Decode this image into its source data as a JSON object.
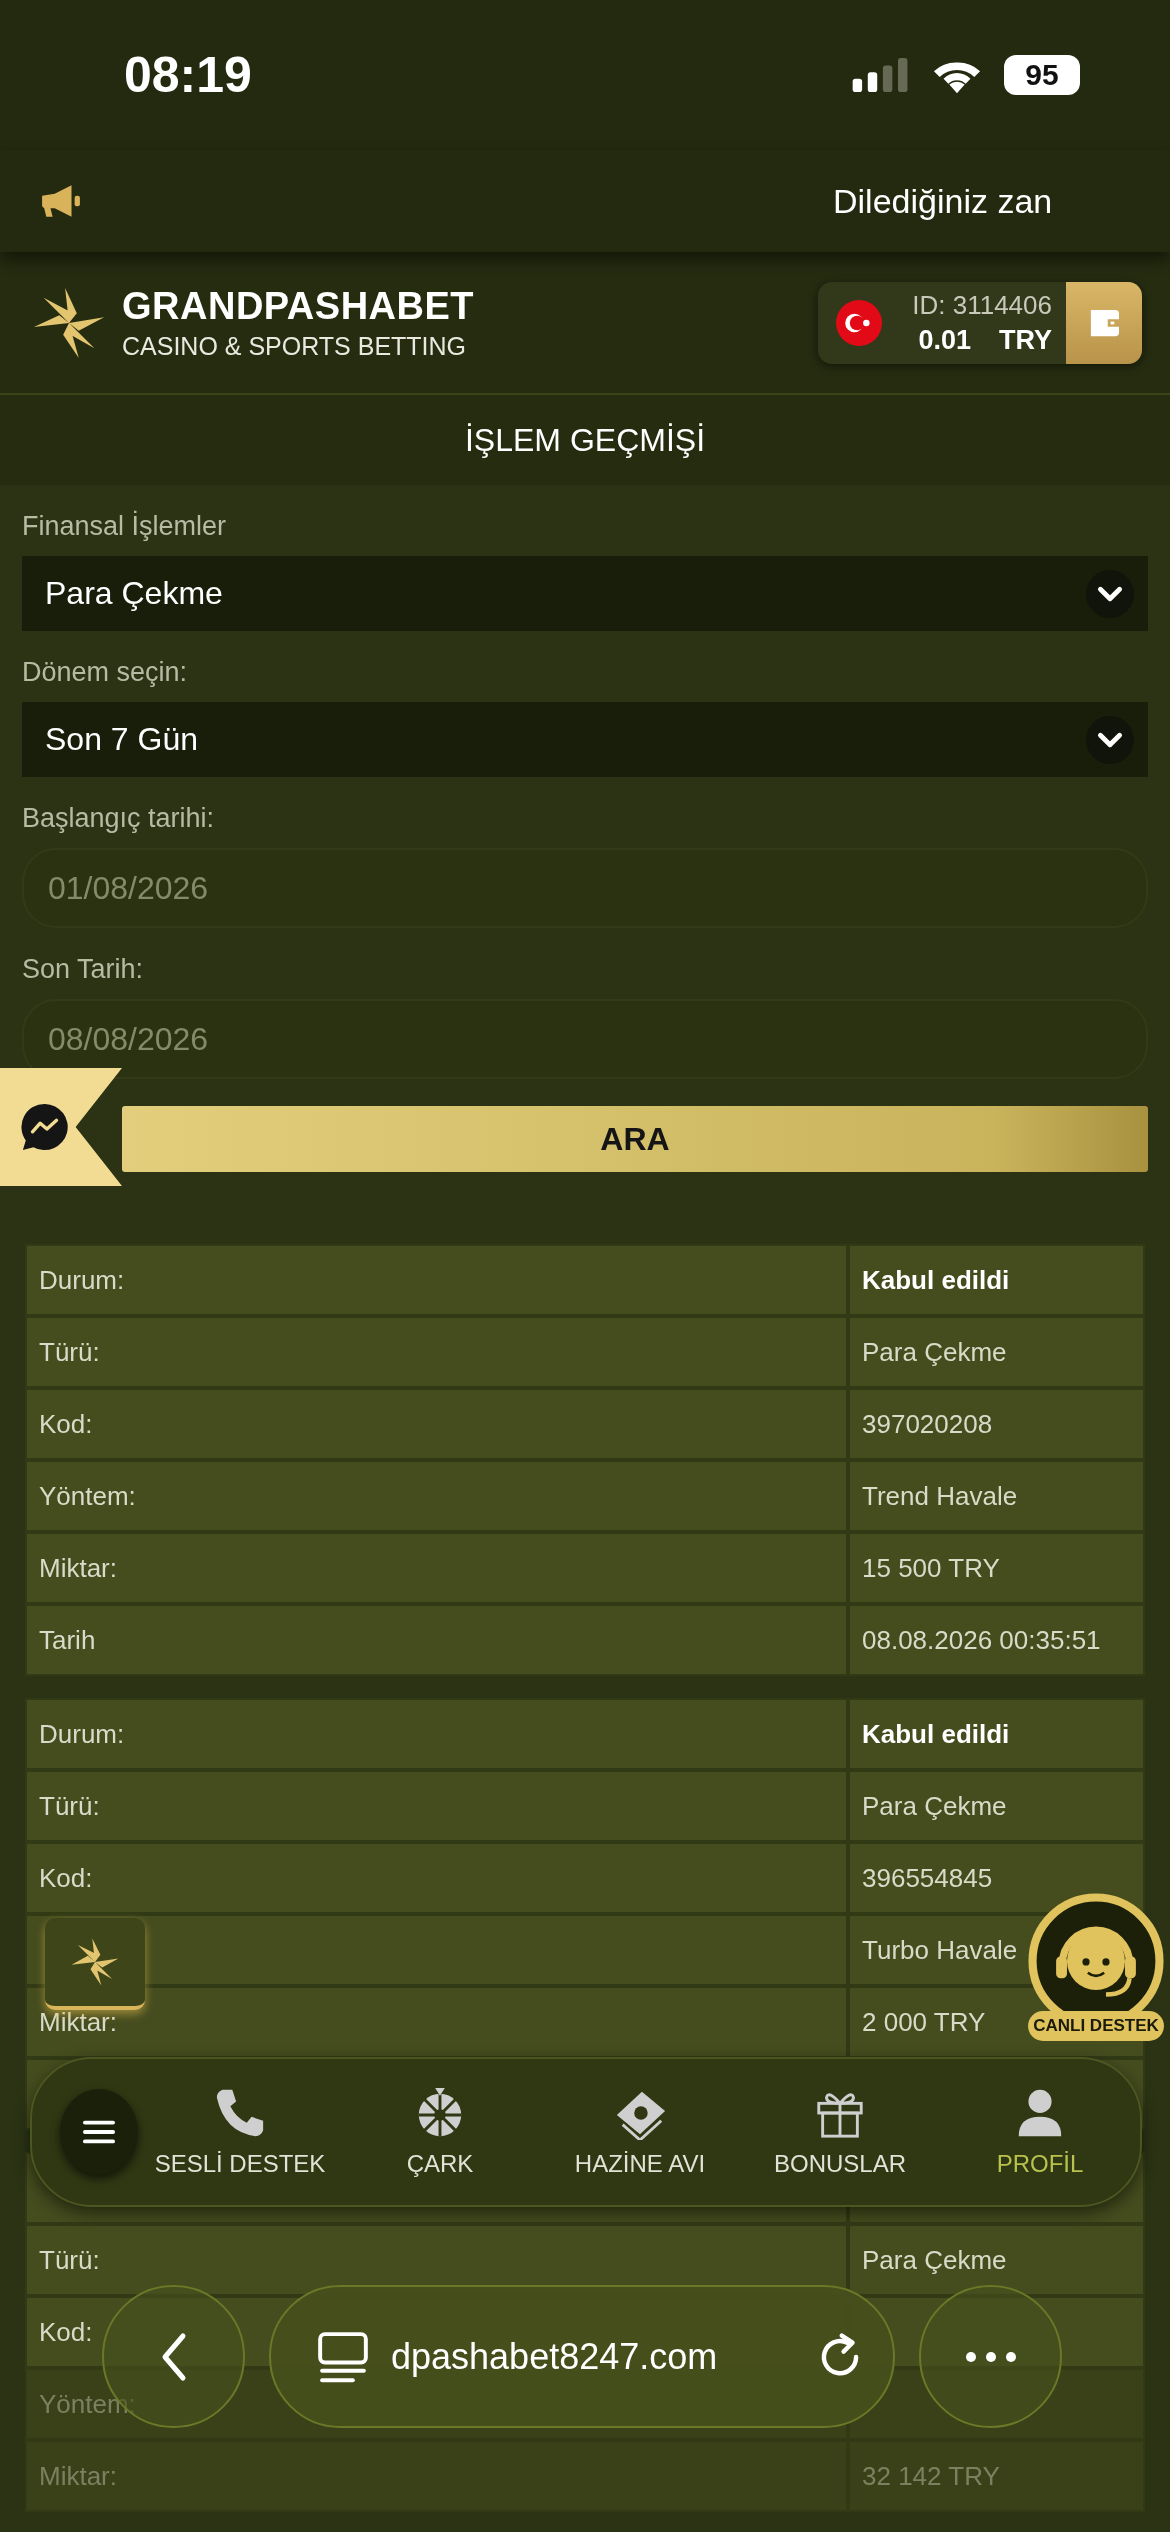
{
  "status_bar": {
    "time": "08:19",
    "battery": "95"
  },
  "announcement": {
    "text": "Dilediğiniz zan"
  },
  "header": {
    "brand": "GRANDPASHABET",
    "tagline": "CASINO & SPORTS BETTING",
    "account": {
      "id": "ID: 3114406",
      "balance": "0.01",
      "currency": "TRY"
    }
  },
  "page_title": "İŞLEM GEÇMİŞİ",
  "filters": [
    {
      "kind": "select",
      "label": "Finansal İşlemler",
      "value": "Para Çekme"
    },
    {
      "kind": "select",
      "label": "Dönem seçin:",
      "value": "Son 7 Gün"
    },
    {
      "kind": "date",
      "label": "Başlangıç tarihi:",
      "value": "01/08/2026"
    },
    {
      "kind": "date",
      "label": "Son Tarih:",
      "value": "08/08/2026"
    }
  ],
  "search_button": "ARA",
  "transactions": [
    {
      "rows": [
        {
          "kind": "status",
          "label": "Durum:",
          "value": "Kabul edildi"
        },
        {
          "kind": "field",
          "label": "Türü:",
          "value": "Para Çekme"
        },
        {
          "kind": "field",
          "label": "Kod:",
          "value": "397020208"
        },
        {
          "kind": "field",
          "label": "Yöntem:",
          "value": "Trend Havale"
        },
        {
          "kind": "field",
          "label": "Miktar:",
          "value": "15 500 TRY"
        },
        {
          "kind": "field",
          "label": "Tarih",
          "value": "08.08.2026 00:35:51"
        }
      ]
    },
    {
      "rows": [
        {
          "kind": "status",
          "label": "Durum:",
          "value": "Kabul edildi"
        },
        {
          "kind": "field",
          "label": "Türü:",
          "value": "Para Çekme"
        },
        {
          "kind": "field",
          "label": "Kod:",
          "value": "396554845"
        },
        {
          "kind": "field",
          "value": "Turbo Havale"
        },
        {
          "kind": "field",
          "label": "Miktar:",
          "value": "2 000 TRY"
        },
        {
          "kind": "field"
        }
      ]
    },
    {
      "rows": [
        {
          "kind": "status"
        },
        {
          "kind": "field",
          "label": "Türü:",
          "value": "Para Çekme"
        },
        {
          "kind": "field",
          "label": "Kod:"
        },
        {
          "kind": "field",
          "label": "Yöntem:",
          "dimmed": true
        },
        {
          "kind": "field",
          "label": "Miktar:",
          "value": "32 142 TRY",
          "dimmed": true
        }
      ]
    }
  ],
  "live_support": {
    "label": "CANLI DESTEK"
  },
  "bottom_nav": {
    "items": [
      {
        "kind": "phone",
        "label": "SESLİ DESTEK",
        "selected": false
      },
      {
        "kind": "wheel",
        "label": "ÇARK",
        "selected": false
      },
      {
        "kind": "money",
        "label": "HAZİNE AVI",
        "selected": false
      },
      {
        "kind": "gift",
        "label": "BONUSLAR",
        "selected": false
      },
      {
        "kind": "person",
        "label": "PROFİL",
        "selected": true
      }
    ]
  },
  "browser": {
    "url": "dpashabet8247.com"
  }
}
